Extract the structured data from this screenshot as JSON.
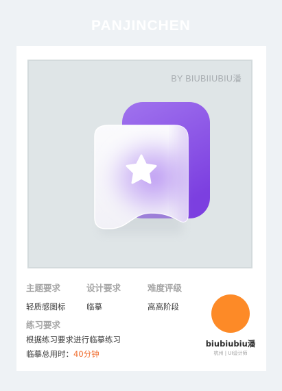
{
  "header": {
    "brand_title": "PANJINCHEN"
  },
  "artboard": {
    "author_tag": "BY BIUBIIUBIU潘",
    "icon": {
      "name": "star-bookmark-icon",
      "front_card_color": "#ffffff",
      "back_card_color": "#8f52e6",
      "star_color": "#ffffff"
    }
  },
  "info": {
    "theme": {
      "label": "主题要求",
      "value": "轻质感图标"
    },
    "design": {
      "label": "设计要求",
      "value": "临摹"
    },
    "difficulty": {
      "label": "难度评级",
      "value": "高高阶段"
    },
    "practice": {
      "label": "练习要求",
      "line1": "根据练习要求进行临摹练习",
      "time_label": "临摹总用时：",
      "time_value": "40分钟"
    }
  },
  "profile": {
    "avatar_color": "#fd8a27",
    "name": "biubiubiu潘",
    "subtitle": "杭州 | UI设计师"
  },
  "colors": {
    "page_background": "#eef2f5",
    "accent_orange": "#ef6a2a",
    "label_gray": "#a6a6a6"
  }
}
